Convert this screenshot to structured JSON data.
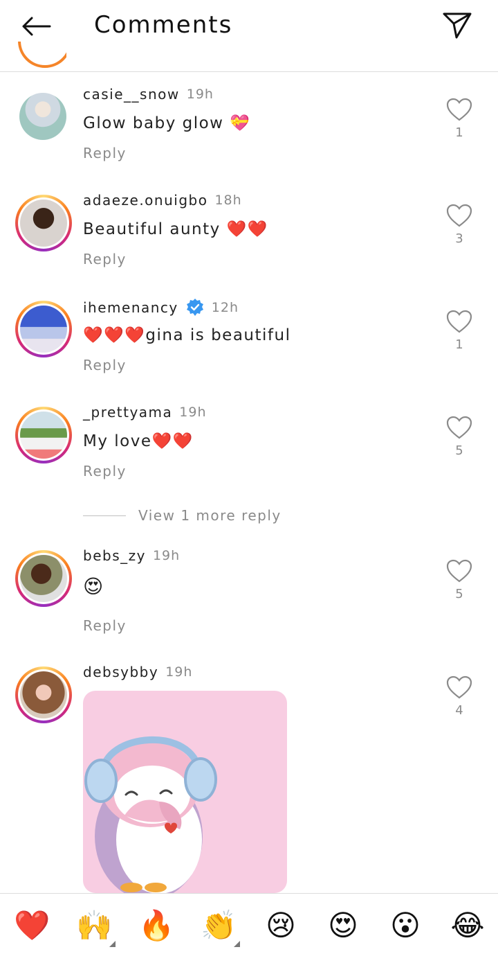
{
  "header": {
    "title": "Comments"
  },
  "comments": [
    {
      "username": "casie__snow",
      "time": "19h",
      "text": "Glow baby glow 💝",
      "reply": "Reply",
      "likes": "1",
      "verified": false
    },
    {
      "username": "adaeze.onuigbo",
      "time": "18h",
      "text": "Beautiful aunty ❤️❤️",
      "reply": "Reply",
      "likes": "3",
      "verified": false
    },
    {
      "username": "ihemenancy",
      "time": "12h",
      "text": "❤️❤️❤️gina is beautiful",
      "reply": "Reply",
      "likes": "1",
      "verified": true
    },
    {
      "username": "_prettyama",
      "time": "19h",
      "text": "My love❤️❤️",
      "reply": "Reply",
      "likes": "5",
      "verified": false
    },
    {
      "username": "bebs_zy",
      "time": "19h",
      "text": "😍",
      "reply": "Reply",
      "likes": "5",
      "verified": false
    },
    {
      "username": "debsybby",
      "time": "19h",
      "text": "",
      "reply": "",
      "likes": "4",
      "verified": false
    }
  ],
  "view_more": "View 1 more reply",
  "emoji_bar": [
    "❤️",
    "🙌",
    "🔥",
    "👏",
    "😢",
    "😍",
    "😮",
    "😂"
  ],
  "colors": {
    "ring_gradient": [
      "#feda75",
      "#fa7e1e",
      "#d62976",
      "#962fbf"
    ],
    "muted_text": "#8a8a8a",
    "verified_blue": "#3897f0"
  },
  "icons": {
    "back": "arrow-left-icon",
    "send": "paper-plane-icon",
    "like": "heart-outline-icon",
    "verified": "verified-badge-icon"
  }
}
